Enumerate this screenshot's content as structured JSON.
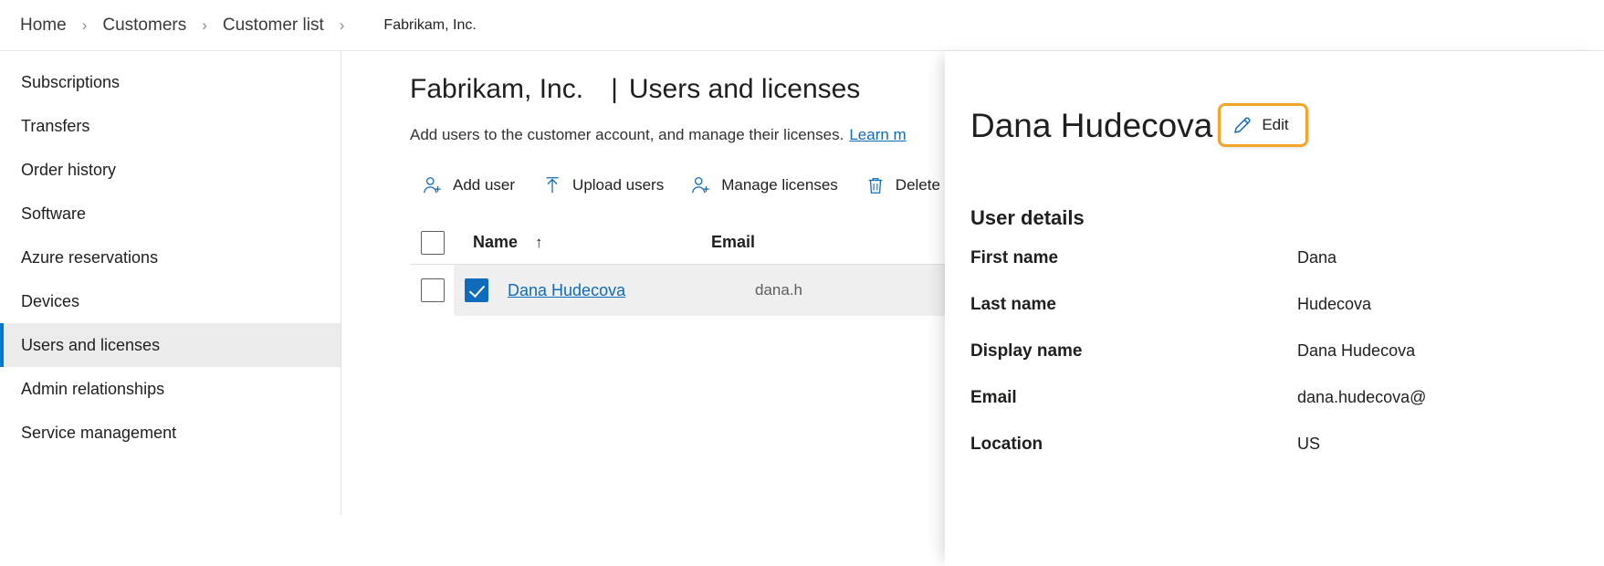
{
  "breadcrumb": {
    "items": [
      {
        "label": "Home"
      },
      {
        "label": "Customers"
      },
      {
        "label": "Customer list"
      }
    ],
    "separator": "›",
    "current": "Fabrikam, Inc."
  },
  "sidebar": {
    "items": [
      {
        "label": "Subscriptions",
        "selected": false
      },
      {
        "label": "Transfers",
        "selected": false
      },
      {
        "label": "Order history",
        "selected": false
      },
      {
        "label": "Software",
        "selected": false
      },
      {
        "label": "Azure reservations",
        "selected": false
      },
      {
        "label": "Devices",
        "selected": false
      },
      {
        "label": "Users and licenses",
        "selected": true
      },
      {
        "label": "Admin relationships",
        "selected": false
      },
      {
        "label": "Service management",
        "selected": false
      }
    ]
  },
  "main": {
    "customer_name": "Fabrikam, Inc.",
    "title_separator": "|",
    "page_title": "Users and licenses",
    "description": "Add users to the customer account, and manage their licenses.",
    "learn_more": "Learn m",
    "toolbar": [
      {
        "label": "Add user",
        "icon": "add-user-icon"
      },
      {
        "label": "Upload users",
        "icon": "upload-icon"
      },
      {
        "label": "Manage licenses",
        "icon": "manage-licenses-icon"
      },
      {
        "label": "Delete",
        "icon": "trash-icon"
      }
    ],
    "table": {
      "columns": [
        {
          "label": "Name",
          "sorted": true,
          "sort_arrow": "↑"
        },
        {
          "label": "Email",
          "sorted": false
        }
      ],
      "rows": [
        {
          "name": "Dana Hudecova",
          "email": "dana.h",
          "selected": true,
          "checked": true
        }
      ]
    }
  },
  "detail_panel": {
    "title": "Dana Hudecova",
    "edit_label": "Edit",
    "edit_icon": "pencil-icon",
    "section_title": "User details",
    "fields": [
      {
        "label": "First name",
        "value": "Dana"
      },
      {
        "label": "Last name",
        "value": "Hudecova"
      },
      {
        "label": "Display name",
        "value": "Dana Hudecova"
      },
      {
        "label": "Email",
        "value": "dana.hudecova@"
      },
      {
        "label": "Location",
        "value": "US"
      }
    ]
  },
  "colors": {
    "accent": "#0078d4",
    "link": "#0f6cbd",
    "highlight_border": "#f2a527",
    "selected_row": "#efefef",
    "selected_nav": "#ebebeb"
  }
}
